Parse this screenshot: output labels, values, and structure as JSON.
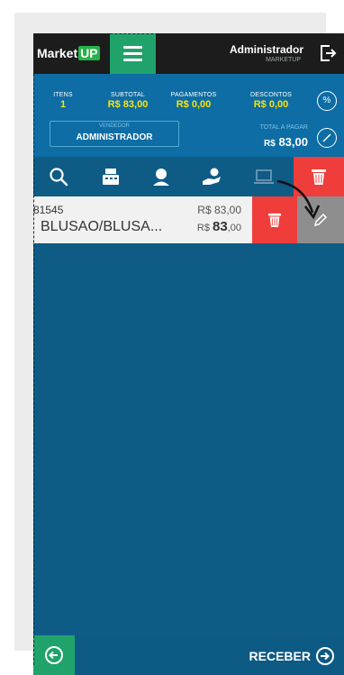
{
  "header": {
    "logo_text": "Market",
    "logo_badge": "UP",
    "user_name": "Administrador",
    "user_company": "MARKETUP"
  },
  "summary": {
    "items_label": "ITENS",
    "items_value": "1",
    "subtotal_label": "SUBTOTAL",
    "subtotal_value": "R$ 83,00",
    "payments_label": "PAGAMENTOS",
    "payments_value": "R$ 0,00",
    "discounts_label": "DESCONTOS",
    "discounts_value": "R$ 0,00",
    "vendor_label": "VENDEDOR",
    "vendor_value": "ADMINISTRADOR",
    "total_label": "TOTAL A PAGAR",
    "total_currency": "R$",
    "total_value": "83,00",
    "percent_symbol": "%"
  },
  "toolbar": {
    "icons": [
      "search-icon",
      "cash-register-icon",
      "customer-icon",
      "payment-hand-icon",
      "laptop-icon",
      "trash-icon"
    ]
  },
  "cart_item": {
    "code": "81545",
    "unit_price": "R$ 83,00",
    "name": "BLUSAO/BLUSA...",
    "total_currency": "R$",
    "total_value": "83",
    "total_cents": ",00"
  },
  "footer": {
    "receive_label": "RECEBER"
  },
  "colors": {
    "header_bg": "#1c1c1c",
    "accent_green": "#1fa36a",
    "summary_bg": "#0d6da4",
    "main_bg": "#0e5b85",
    "danger_red": "#ef3d3c",
    "highlight_yellow": "#ffe400"
  }
}
